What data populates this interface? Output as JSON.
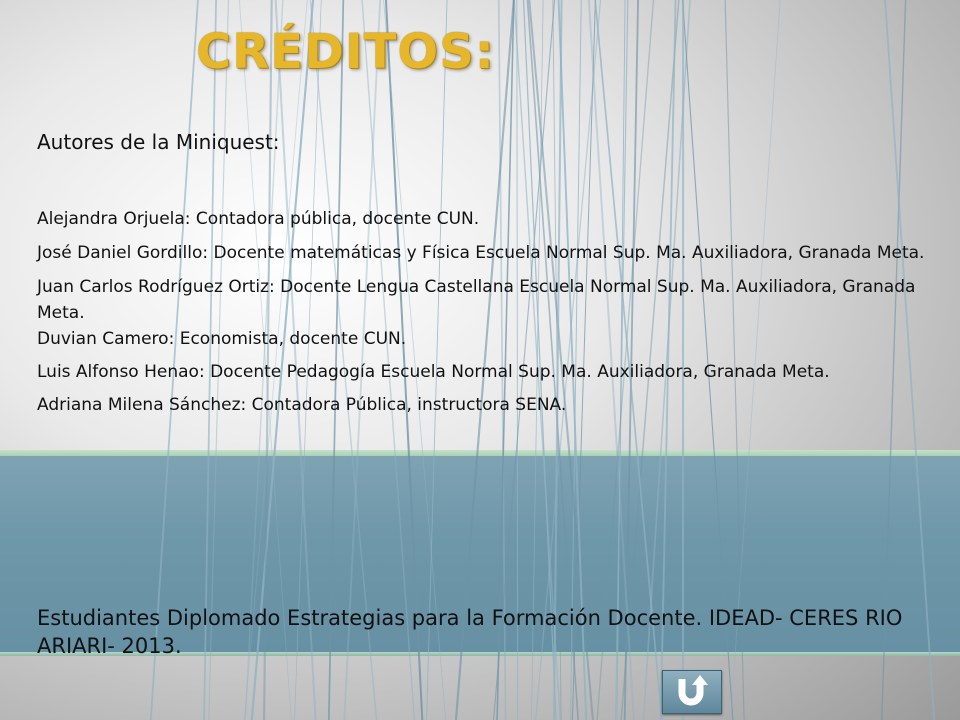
{
  "title": "CRÉDITOS:",
  "heading": "Autores de la Miniquest:",
  "authors": [
    "Alejandra Orjuela: Contadora pública, docente CUN.",
    "José Daniel Gordillo: Docente matemáticas y Física Escuela Normal Sup. Ma. Auxiliadora, Granada Meta.",
    "Juan Carlos Rodríguez Ortiz: Docente Lengua Castellana Escuela Normal Sup. Ma. Auxiliadora, Granada Meta.",
    "Duvian Camero: Economista, docente CUN.",
    "Luis Alfonso Henao: Docente Pedagogía Escuela Normal Sup. Ma. Auxiliadora, Granada Meta.",
    "Adriana Milena Sánchez: Contadora Pública, instructora SENA."
  ],
  "footer": "Estudiantes Diplomado Estrategias para la Formación Docente.  IDEAD- CERES RIO ARIARI- 2013.",
  "nav_button": {
    "icon": "u-turn-return-icon"
  },
  "colors": {
    "title": "#e6b62b",
    "band": "#6f98aa",
    "band_edge": "#b7d8c3",
    "lines": "#8fb2c4"
  }
}
